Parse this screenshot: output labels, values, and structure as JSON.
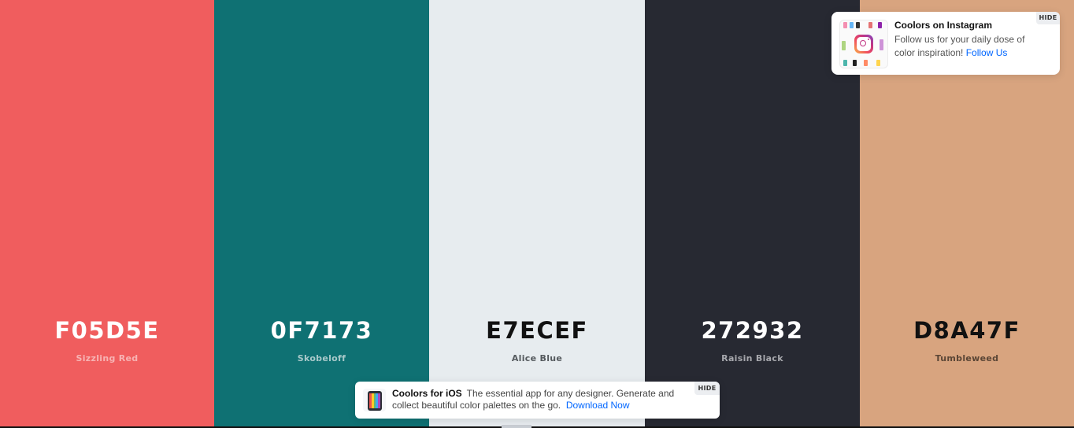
{
  "palette": {
    "colors": [
      {
        "hex": "F05D5E",
        "name": "Sizzling Red",
        "bg": "#F05D5E",
        "text_color": "#ffffff",
        "name_color": "#f7b3b3"
      },
      {
        "hex": "0F7173",
        "name": "Skobeloff",
        "bg": "#0F7173",
        "text_color": "#ffffff",
        "name_color": "#a9c9ca"
      },
      {
        "hex": "E7ECEF",
        "name": "Alice Blue",
        "bg": "#E7ECEF",
        "text_color": "#111111",
        "name_color": "#555a5e"
      },
      {
        "hex": "272932",
        "name": "Raisin Black",
        "bg": "#272932",
        "text_color": "#ffffff",
        "name_color": "#a7a8ad"
      },
      {
        "hex": "D8A47F",
        "name": "Tumbleweed",
        "bg": "#D8A47F",
        "text_color": "#111111",
        "name_color": "#5a4535"
      }
    ]
  },
  "instagram_card": {
    "title": "Coolors on Instagram",
    "body": "Follow us for your daily dose of color inspiration!",
    "link": "Follow Us",
    "hide_label": "HIDE",
    "icon": "instagram-icon"
  },
  "ios_card": {
    "title": "Coolors for iOS",
    "body": "The essential app for any designer. Generate and collect beautiful color palettes on the go.",
    "link": "Download Now",
    "hide_label": "HIDE",
    "icon": "phone-app-icon"
  }
}
